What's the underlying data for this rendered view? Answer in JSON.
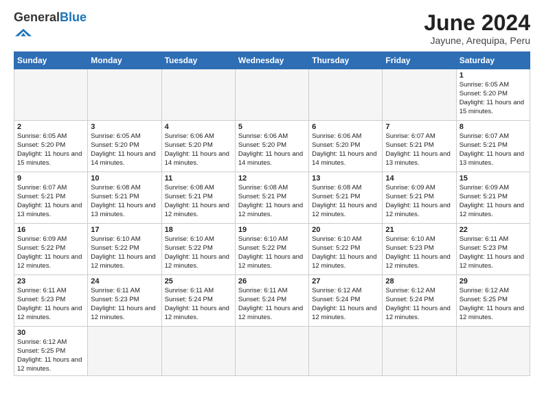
{
  "header": {
    "logo_general": "General",
    "logo_blue": "Blue",
    "month_title": "June 2024",
    "location": "Jayune, Arequipa, Peru"
  },
  "weekdays": [
    "Sunday",
    "Monday",
    "Tuesday",
    "Wednesday",
    "Thursday",
    "Friday",
    "Saturday"
  ],
  "weeks": [
    [
      {
        "day": "",
        "sunrise": "",
        "sunset": "",
        "daylight": "",
        "empty": true
      },
      {
        "day": "",
        "sunrise": "",
        "sunset": "",
        "daylight": "",
        "empty": true
      },
      {
        "day": "",
        "sunrise": "",
        "sunset": "",
        "daylight": "",
        "empty": true
      },
      {
        "day": "",
        "sunrise": "",
        "sunset": "",
        "daylight": "",
        "empty": true
      },
      {
        "day": "",
        "sunrise": "",
        "sunset": "",
        "daylight": "",
        "empty": true
      },
      {
        "day": "",
        "sunrise": "",
        "sunset": "",
        "daylight": "",
        "empty": true
      },
      {
        "day": "1",
        "sunrise": "Sunrise: 6:05 AM",
        "sunset": "Sunset: 5:20 PM",
        "daylight": "Daylight: 11 hours and 15 minutes.",
        "empty": false
      }
    ],
    [
      {
        "day": "2",
        "sunrise": "Sunrise: 6:05 AM",
        "sunset": "Sunset: 5:20 PM",
        "daylight": "Daylight: 11 hours and 15 minutes.",
        "empty": false
      },
      {
        "day": "3",
        "sunrise": "Sunrise: 6:05 AM",
        "sunset": "Sunset: 5:20 PM",
        "daylight": "Daylight: 11 hours and 14 minutes.",
        "empty": false
      },
      {
        "day": "4",
        "sunrise": "Sunrise: 6:06 AM",
        "sunset": "Sunset: 5:20 PM",
        "daylight": "Daylight: 11 hours and 14 minutes.",
        "empty": false
      },
      {
        "day": "5",
        "sunrise": "Sunrise: 6:06 AM",
        "sunset": "Sunset: 5:20 PM",
        "daylight": "Daylight: 11 hours and 14 minutes.",
        "empty": false
      },
      {
        "day": "6",
        "sunrise": "Sunrise: 6:06 AM",
        "sunset": "Sunset: 5:20 PM",
        "daylight": "Daylight: 11 hours and 14 minutes.",
        "empty": false
      },
      {
        "day": "7",
        "sunrise": "Sunrise: 6:07 AM",
        "sunset": "Sunset: 5:21 PM",
        "daylight": "Daylight: 11 hours and 13 minutes.",
        "empty": false
      },
      {
        "day": "8",
        "sunrise": "Sunrise: 6:07 AM",
        "sunset": "Sunset: 5:21 PM",
        "daylight": "Daylight: 11 hours and 13 minutes.",
        "empty": false
      }
    ],
    [
      {
        "day": "9",
        "sunrise": "Sunrise: 6:07 AM",
        "sunset": "Sunset: 5:21 PM",
        "daylight": "Daylight: 11 hours and 13 minutes.",
        "empty": false
      },
      {
        "day": "10",
        "sunrise": "Sunrise: 6:08 AM",
        "sunset": "Sunset: 5:21 PM",
        "daylight": "Daylight: 11 hours and 13 minutes.",
        "empty": false
      },
      {
        "day": "11",
        "sunrise": "Sunrise: 6:08 AM",
        "sunset": "Sunset: 5:21 PM",
        "daylight": "Daylight: 11 hours and 12 minutes.",
        "empty": false
      },
      {
        "day": "12",
        "sunrise": "Sunrise: 6:08 AM",
        "sunset": "Sunset: 5:21 PM",
        "daylight": "Daylight: 11 hours and 12 minutes.",
        "empty": false
      },
      {
        "day": "13",
        "sunrise": "Sunrise: 6:08 AM",
        "sunset": "Sunset: 5:21 PM",
        "daylight": "Daylight: 11 hours and 12 minutes.",
        "empty": false
      },
      {
        "day": "14",
        "sunrise": "Sunrise: 6:09 AM",
        "sunset": "Sunset: 5:21 PM",
        "daylight": "Daylight: 11 hours and 12 minutes.",
        "empty": false
      },
      {
        "day": "15",
        "sunrise": "Sunrise: 6:09 AM",
        "sunset": "Sunset: 5:21 PM",
        "daylight": "Daylight: 11 hours and 12 minutes.",
        "empty": false
      }
    ],
    [
      {
        "day": "16",
        "sunrise": "Sunrise: 6:09 AM",
        "sunset": "Sunset: 5:22 PM",
        "daylight": "Daylight: 11 hours and 12 minutes.",
        "empty": false
      },
      {
        "day": "17",
        "sunrise": "Sunrise: 6:10 AM",
        "sunset": "Sunset: 5:22 PM",
        "daylight": "Daylight: 11 hours and 12 minutes.",
        "empty": false
      },
      {
        "day": "18",
        "sunrise": "Sunrise: 6:10 AM",
        "sunset": "Sunset: 5:22 PM",
        "daylight": "Daylight: 11 hours and 12 minutes.",
        "empty": false
      },
      {
        "day": "19",
        "sunrise": "Sunrise: 6:10 AM",
        "sunset": "Sunset: 5:22 PM",
        "daylight": "Daylight: 11 hours and 12 minutes.",
        "empty": false
      },
      {
        "day": "20",
        "sunrise": "Sunrise: 6:10 AM",
        "sunset": "Sunset: 5:22 PM",
        "daylight": "Daylight: 11 hours and 12 minutes.",
        "empty": false
      },
      {
        "day": "21",
        "sunrise": "Sunrise: 6:10 AM",
        "sunset": "Sunset: 5:23 PM",
        "daylight": "Daylight: 11 hours and 12 minutes.",
        "empty": false
      },
      {
        "day": "22",
        "sunrise": "Sunrise: 6:11 AM",
        "sunset": "Sunset: 5:23 PM",
        "daylight": "Daylight: 11 hours and 12 minutes.",
        "empty": false
      }
    ],
    [
      {
        "day": "23",
        "sunrise": "Sunrise: 6:11 AM",
        "sunset": "Sunset: 5:23 PM",
        "daylight": "Daylight: 11 hours and 12 minutes.",
        "empty": false
      },
      {
        "day": "24",
        "sunrise": "Sunrise: 6:11 AM",
        "sunset": "Sunset: 5:23 PM",
        "daylight": "Daylight: 11 hours and 12 minutes.",
        "empty": false
      },
      {
        "day": "25",
        "sunrise": "Sunrise: 6:11 AM",
        "sunset": "Sunset: 5:24 PM",
        "daylight": "Daylight: 11 hours and 12 minutes.",
        "empty": false
      },
      {
        "day": "26",
        "sunrise": "Sunrise: 6:11 AM",
        "sunset": "Sunset: 5:24 PM",
        "daylight": "Daylight: 11 hours and 12 minutes.",
        "empty": false
      },
      {
        "day": "27",
        "sunrise": "Sunrise: 6:12 AM",
        "sunset": "Sunset: 5:24 PM",
        "daylight": "Daylight: 11 hours and 12 minutes.",
        "empty": false
      },
      {
        "day": "28",
        "sunrise": "Sunrise: 6:12 AM",
        "sunset": "Sunset: 5:24 PM",
        "daylight": "Daylight: 11 hours and 12 minutes.",
        "empty": false
      },
      {
        "day": "29",
        "sunrise": "Sunrise: 6:12 AM",
        "sunset": "Sunset: 5:25 PM",
        "daylight": "Daylight: 11 hours and 12 minutes.",
        "empty": false
      }
    ],
    [
      {
        "day": "30",
        "sunrise": "Sunrise: 6:12 AM",
        "sunset": "Sunset: 5:25 PM",
        "daylight": "Daylight: 11 hours and 12 minutes.",
        "empty": false
      },
      {
        "day": "",
        "sunrise": "",
        "sunset": "",
        "daylight": "",
        "empty": true
      },
      {
        "day": "",
        "sunrise": "",
        "sunset": "",
        "daylight": "",
        "empty": true
      },
      {
        "day": "",
        "sunrise": "",
        "sunset": "",
        "daylight": "",
        "empty": true
      },
      {
        "day": "",
        "sunrise": "",
        "sunset": "",
        "daylight": "",
        "empty": true
      },
      {
        "day": "",
        "sunrise": "",
        "sunset": "",
        "daylight": "",
        "empty": true
      },
      {
        "day": "",
        "sunrise": "",
        "sunset": "",
        "daylight": "",
        "empty": true
      }
    ]
  ]
}
